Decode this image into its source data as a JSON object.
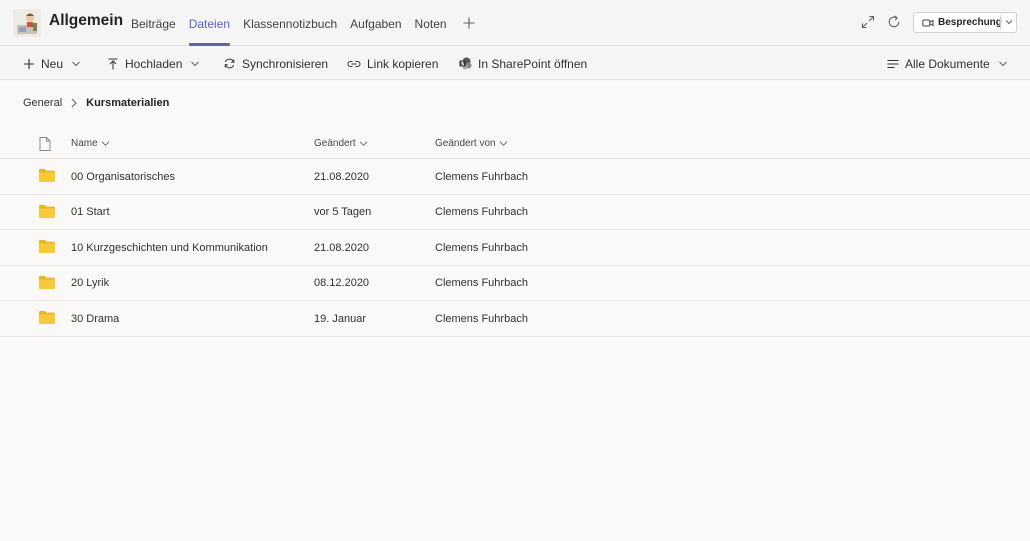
{
  "header": {
    "channel_title": "Allgemein",
    "tabs": [
      {
        "label": "Beiträge",
        "active": false
      },
      {
        "label": "Dateien",
        "active": true
      },
      {
        "label": "Klassennotizbuch",
        "active": false
      },
      {
        "label": "Aufgaben",
        "active": false
      },
      {
        "label": "Noten",
        "active": false
      }
    ],
    "meet_label": "Besprechung",
    "accent_color": "#6264a7"
  },
  "toolbar": {
    "new_label": "Neu",
    "upload_label": "Hochladen",
    "sync_label": "Synchronisieren",
    "copy_link_label": "Link kopieren",
    "sharepoint_label": "In SharePoint öffnen",
    "view_label": "Alle Dokumente"
  },
  "breadcrumb": {
    "parent": "General",
    "current": "Kursmaterialien"
  },
  "list": {
    "columns": {
      "name": "Name",
      "modified": "Geändert",
      "modified_by": "Geändert von"
    },
    "rows": [
      {
        "name": "00 Organisatorisches",
        "modified": "21.08.2020",
        "modified_by": "Clemens Fuhrbach"
      },
      {
        "name": "01 Start",
        "modified": "vor 5 Tagen",
        "modified_by": "Clemens Fuhrbach"
      },
      {
        "name": "10 Kurzgeschichten und Kommunikation",
        "modified": "21.08.2020",
        "modified_by": "Clemens Fuhrbach"
      },
      {
        "name": "20 Lyrik",
        "modified": "08.12.2020",
        "modified_by": "Clemens Fuhrbach"
      },
      {
        "name": "30 Drama",
        "modified": "19. Januar",
        "modified_by": "Clemens Fuhrbach"
      }
    ],
    "folder_color": "#f8c93a"
  }
}
